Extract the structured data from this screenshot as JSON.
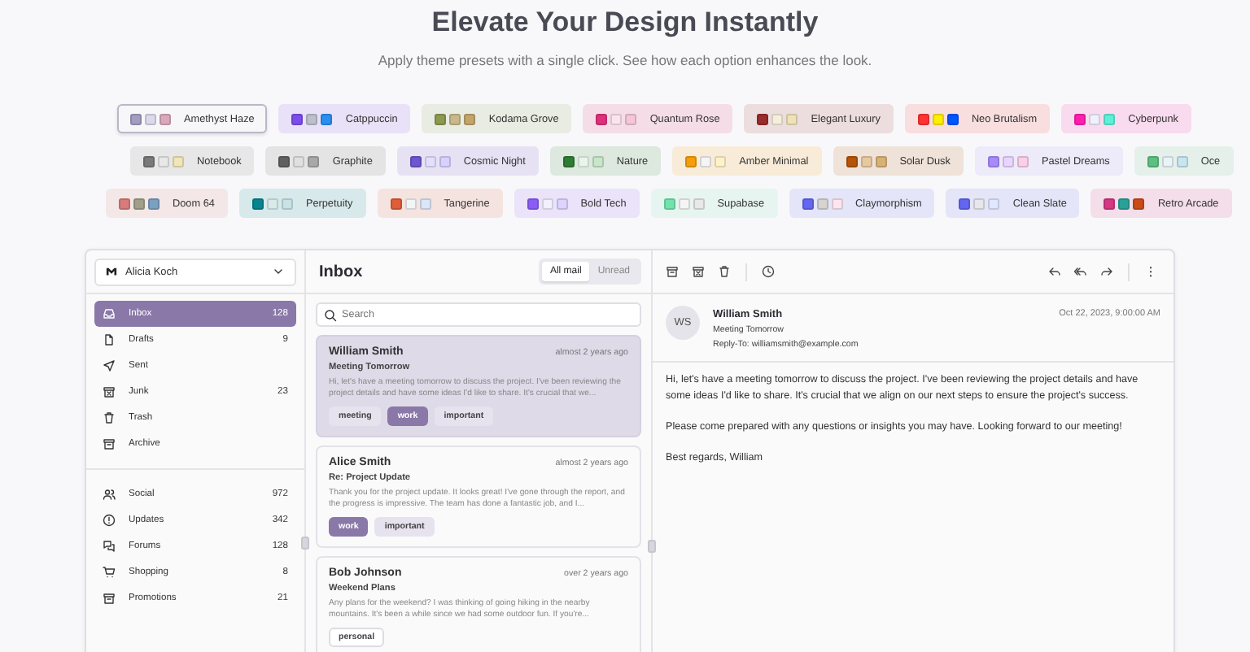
{
  "header": {
    "title": "Elevate Your Design Instantly",
    "subtitle": "Apply theme presets with a single click. See how each option enhances the look."
  },
  "theme_rows": [
    {
      "themes": [
        {
          "label": "Amethyst Haze",
          "selected": true,
          "dots": [
            {
              "color": "#a39dc0"
            },
            {
              "color": "#dcdaea"
            },
            {
              "color": "#d9a9b9"
            }
          ]
        },
        {
          "label": "Catppuccin",
          "selected": false,
          "dots": [
            {
              "color": "#7c4dea"
            },
            {
              "color": "#bcc0cc"
            },
            {
              "color": "#2b8ff0"
            }
          ]
        },
        {
          "label": "Kodama Grove",
          "selected": false,
          "dots": [
            {
              "color": "#8a9a4e"
            },
            {
              "color": "#c9b98a"
            },
            {
              "color": "#c2a56a"
            }
          ]
        },
        {
          "label": "Quantum Rose",
          "selected": false,
          "dots": [
            {
              "color": "#e0307a"
            },
            {
              "color": "#fce4ee"
            },
            {
              "color": "#f5c6d8"
            }
          ]
        },
        {
          "label": "Elegant Luxury",
          "selected": false,
          "dots": [
            {
              "color": "#9b2c2c"
            },
            {
              "color": "#f7efdc"
            },
            {
              "color": "#f0e2b8"
            }
          ]
        },
        {
          "label": "Neo Brutalism",
          "selected": false,
          "dots": [
            {
              "color": "#ff3333"
            },
            {
              "color": "#ffee00"
            },
            {
              "color": "#0055ff"
            }
          ]
        },
        {
          "label": "Cyberpunk",
          "selected": false,
          "dots": [
            {
              "color": "#ff1fae"
            },
            {
              "color": "#f0f0ff"
            },
            {
              "color": "#5ef0d8"
            }
          ]
        }
      ]
    },
    {
      "themes": [
        {
          "label": "Notebook",
          "selected": false,
          "dots": [
            {
              "color": "#7a7a7a"
            },
            {
              "color": "#e8e8e8"
            },
            {
              "color": "#f0e6b8"
            }
          ]
        },
        {
          "label": "Graphite",
          "selected": false,
          "dots": [
            {
              "color": "#606060"
            },
            {
              "color": "#e0e0e0"
            },
            {
              "color": "#a8a8a8"
            }
          ]
        },
        {
          "label": "Cosmic Night",
          "selected": false,
          "dots": [
            {
              "color": "#6e56cf"
            },
            {
              "color": "#e4dfff"
            },
            {
              "color": "#d8d0ff"
            }
          ]
        },
        {
          "label": "Nature",
          "selected": false,
          "dots": [
            {
              "color": "#2e7d32"
            },
            {
              "color": "#e8f5e9"
            },
            {
              "color": "#c8e6c9"
            }
          ]
        },
        {
          "label": "Amber Minimal",
          "selected": false,
          "dots": [
            {
              "color": "#f59e0b"
            },
            {
              "color": "#f5f5f5"
            },
            {
              "color": "#fef3c7"
            }
          ]
        },
        {
          "label": "Solar Dusk",
          "selected": false,
          "dots": [
            {
              "color": "#b45309"
            },
            {
              "color": "#e7c9a0"
            },
            {
              "color": "#d6b277"
            }
          ]
        },
        {
          "label": "Pastel Dreams",
          "selected": false,
          "dots": [
            {
              "color": "#a78bfa"
            },
            {
              "color": "#e9d5ff"
            },
            {
              "color": "#fbcfe8"
            }
          ]
        },
        {
          "label": "Oce",
          "selected": false,
          "dots": [
            {
              "color": "#5fbf80"
            },
            {
              "color": "#e8f4f8"
            },
            {
              "color": "#c8e6f0"
            }
          ]
        }
      ]
    },
    {
      "themes": [
        {
          "label": "Doom 64",
          "selected": false,
          "dots": [
            {
              "color": "#d97b7b"
            },
            {
              "color": "#a0a08a"
            },
            {
              "color": "#7ba0c0"
            }
          ]
        },
        {
          "label": "Perpetuity",
          "selected": false,
          "dots": [
            {
              "color": "#06858e"
            },
            {
              "color": "#d8eaea"
            },
            {
              "color": "#c8e2e6"
            }
          ]
        },
        {
          "label": "Tangerine",
          "selected": false,
          "dots": [
            {
              "color": "#e05d38"
            },
            {
              "color": "#f3f4f6"
            },
            {
              "color": "#dbe6f6"
            }
          ]
        },
        {
          "label": "Bold Tech",
          "selected": false,
          "dots": [
            {
              "color": "#8b5cf6"
            },
            {
              "color": "#f3f0ff"
            },
            {
              "color": "#dcd4ff"
            }
          ]
        },
        {
          "label": "Supabase",
          "selected": false,
          "dots": [
            {
              "color": "#72e3ad"
            },
            {
              "color": "#f5f5f5"
            },
            {
              "color": "#e8e8e8"
            }
          ]
        },
        {
          "label": "Claymorphism",
          "selected": false,
          "dots": [
            {
              "color": "#6366f1"
            },
            {
              "color": "#d6d3d1"
            },
            {
              "color": "#fbe6f0"
            }
          ]
        },
        {
          "label": "Clean Slate",
          "selected": false,
          "dots": [
            {
              "color": "#6366f1"
            },
            {
              "color": "#e5e7eb"
            },
            {
              "color": "#e0e7ff"
            }
          ]
        },
        {
          "label": "Retro Arcade",
          "selected": false,
          "dots": [
            {
              "color": "#d33682"
            },
            {
              "color": "#2aa198"
            },
            {
              "color": "#cb4b16"
            }
          ]
        }
      ]
    }
  ],
  "mail": {
    "account": {
      "name": "Alicia Koch"
    },
    "nav_primary": [
      {
        "label": "Inbox",
        "count": "128",
        "selected": true
      },
      {
        "label": "Drafts",
        "count": "9",
        "selected": false
      },
      {
        "label": "Sent",
        "selected": false
      },
      {
        "label": "Junk",
        "count": "23",
        "selected": false
      },
      {
        "label": "Trash",
        "selected": false
      },
      {
        "label": "Archive",
        "selected": false
      }
    ],
    "nav_secondary": [
      {
        "label": "Social",
        "count": "972",
        "selected": false
      },
      {
        "label": "Updates",
        "count": "342",
        "selected": false
      },
      {
        "label": "Forums",
        "count": "128",
        "selected": false
      },
      {
        "label": "Shopping",
        "count": "8",
        "selected": false
      },
      {
        "label": "Promotions",
        "count": "21",
        "selected": false
      }
    ],
    "list": {
      "title": "Inbox",
      "filters": [
        {
          "label": "All mail",
          "selected": true
        },
        {
          "label": "Unread",
          "selected": false
        }
      ],
      "search": {
        "placeholder": "Search"
      },
      "messages": [
        {
          "name": "William Smith",
          "time": "almost 2 years ago",
          "subject": "Meeting Tomorrow",
          "preview": "Hi, let's have a meeting tomorrow to discuss the project. I've been reviewing the project details and have some ideas I'd like to share. It's crucial that we...",
          "selected": true,
          "tags": [
            {
              "label": "meeting",
              "kind": "secondary"
            },
            {
              "label": "work",
              "kind": "primary"
            },
            {
              "label": "important",
              "kind": "secondary"
            }
          ]
        },
        {
          "name": "Alice Smith",
          "time": "almost 2 years ago",
          "subject": "Re: Project Update",
          "preview": "Thank you for the project update. It looks great! I've gone through the report, and the progress is impressive. The team has done a fantastic job, and I...",
          "selected": false,
          "tags": [
            {
              "label": "work",
              "kind": "primary"
            },
            {
              "label": "important",
              "kind": "secondary"
            }
          ]
        },
        {
          "name": "Bob Johnson",
          "time": "over 2 years ago",
          "subject": "Weekend Plans",
          "preview": "Any plans for the weekend? I was thinking of going hiking in the nearby mountains. It's been a while since we had some outdoor fun. If you're...",
          "selected": false,
          "tags": [
            {
              "label": "personal",
              "kind": "outline"
            }
          ]
        }
      ]
    },
    "reader": {
      "initials": "WS",
      "name": "William Smith",
      "subject": "Meeting Tomorrow",
      "reply_to": "Reply-To: williamsmith@example.com",
      "date": "Oct 22, 2023, 9:00:00 AM",
      "paragraphs": [
        "Hi, let's have a meeting tomorrow to discuss the project. I've been reviewing the project details and have some ideas I'd like to share. It's crucial that we align on our next steps to ensure the project's success.",
        "Please come prepared with any questions or insights you may have. Looking forward to our meeting!",
        "Best regards, William"
      ]
    }
  }
}
